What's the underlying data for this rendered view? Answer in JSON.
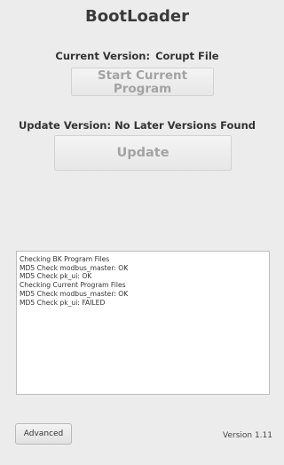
{
  "window": {
    "title": "BootLoader"
  },
  "current": {
    "label": "Current Version:",
    "value": "Corupt File",
    "start_button_line1": "Start Current",
    "start_button_line2": "Program"
  },
  "update": {
    "label": "Update Version:",
    "value": "No Later Versions Found",
    "button_label": "Update"
  },
  "log": {
    "lines": [
      "Checking BK Program Files",
      "MD5 Check modbus_master: OK",
      "MD5 Check pk_ui: OK",
      "Checking Current Program Files",
      "MD5 Check modbus_master: OK",
      "MD5 Check pk_ui: FAILED"
    ]
  },
  "footer": {
    "advanced_button": "Advanced",
    "version_text": "Version 1.11"
  }
}
